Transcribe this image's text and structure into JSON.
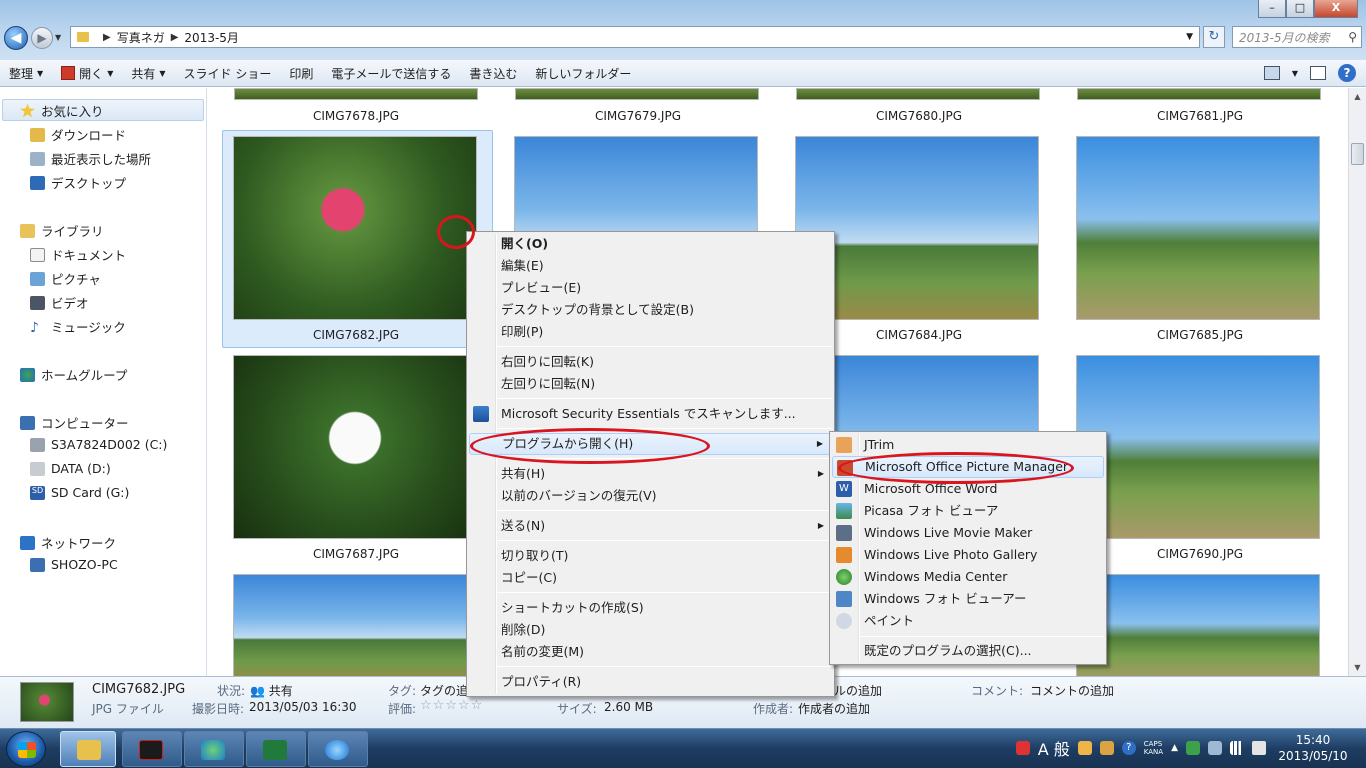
{
  "window": {
    "address": {
      "root": "写真ネガ",
      "current": "2013-5月"
    },
    "search_placeholder": "2013-5月の検索",
    "controls": {
      "minimize": "–",
      "maximize": "□",
      "close": "X"
    }
  },
  "toolbar": {
    "organize": "整理",
    "open": "開く",
    "share": "共有",
    "slideshow": "スライド ショー",
    "print": "印刷",
    "email": "電子メールで送信する",
    "burn": "書き込む",
    "new_folder": "新しいフォルダー",
    "help": "?"
  },
  "nav": {
    "favorites": "お気に入り",
    "downloads": "ダウンロード",
    "recent": "最近表示した場所",
    "desktop": "デスクトップ",
    "libraries": "ライブラリ",
    "documents": "ドキュメント",
    "pictures": "ピクチャ",
    "videos": "ビデオ",
    "music": "ミュージック",
    "homegroup": "ホームグループ",
    "computer": "コンピューター",
    "drive_c": "S3A7824D002 (C:)",
    "drive_d": "DATA (D:)",
    "drive_g": "SD Card (G:)",
    "network": "ネットワーク",
    "pc": "SHOZO-PC"
  },
  "files": {
    "f7678": "CIMG7678.JPG",
    "f7679": "CIMG7679.JPG",
    "f7680": "CIMG7680.JPG",
    "f7681": "CIMG7681.JPG",
    "f7682": "CIMG7682.JPG",
    "f7684": "CIMG7684.JPG",
    "f7685": "CIMG7685.JPG",
    "f7687": "CIMG7687.JPG",
    "f7690": "CIMG7690.JPG"
  },
  "context_menu": {
    "open": "開く(O)",
    "edit": "編集(E)",
    "preview": "プレビュー(E)",
    "set_background": "デスクトップの背景として設定(B)",
    "print": "印刷(P)",
    "rotate_cw": "右回りに回転(K)",
    "rotate_ccw": "左回りに回転(N)",
    "mse_scan": "Microsoft Security Essentials でスキャンします...",
    "open_with": "プログラムから開く(H)",
    "share": "共有(H)",
    "restore": "以前のバージョンの復元(V)",
    "send_to": "送る(N)",
    "cut": "切り取り(T)",
    "copy": "コピー(C)",
    "create_shortcut": "ショートカットの作成(S)",
    "delete": "削除(D)",
    "rename": "名前の変更(M)",
    "properties": "プロパティ(R)"
  },
  "submenu": {
    "jtrim": "JTrim",
    "office_picture_manager": "Microsoft Office Picture Manager",
    "office_word": "Microsoft Office Word",
    "picasa": "Picasa フォト ビューア",
    "movie_maker": "Windows Live Movie Maker",
    "photo_gallery": "Windows Live Photo Gallery",
    "media_center": "Windows Media Center",
    "photo_viewer": "Windows フォト ビューアー",
    "paint": "ペイント",
    "choose_default": "既定のプログラムの選択(C)..."
  },
  "details": {
    "filename": "CIMG7682.JPG",
    "filetype": "JPG ファイル",
    "status_label": "状況:",
    "status_value": "共有",
    "date_label": "撮影日時:",
    "date_value": "2013/05/03 16:30",
    "tags_label": "タグ:",
    "tags_value": "タグの追",
    "rating_label": "評価:",
    "rating_stars": "☆☆☆☆☆",
    "size_label": "サイズ:",
    "size_value": "2.60 MB",
    "title_partial": "ルの追加",
    "author_label": "作成者:",
    "author_value": "作成者の追加",
    "comment_label": "コメント:",
    "comment_value": "コメントの追加"
  },
  "taskbar": {
    "ime_mode": "A 般",
    "caps": "CAPS",
    "kana": "KANA",
    "time": "15:40",
    "date": "2013/05/10"
  }
}
